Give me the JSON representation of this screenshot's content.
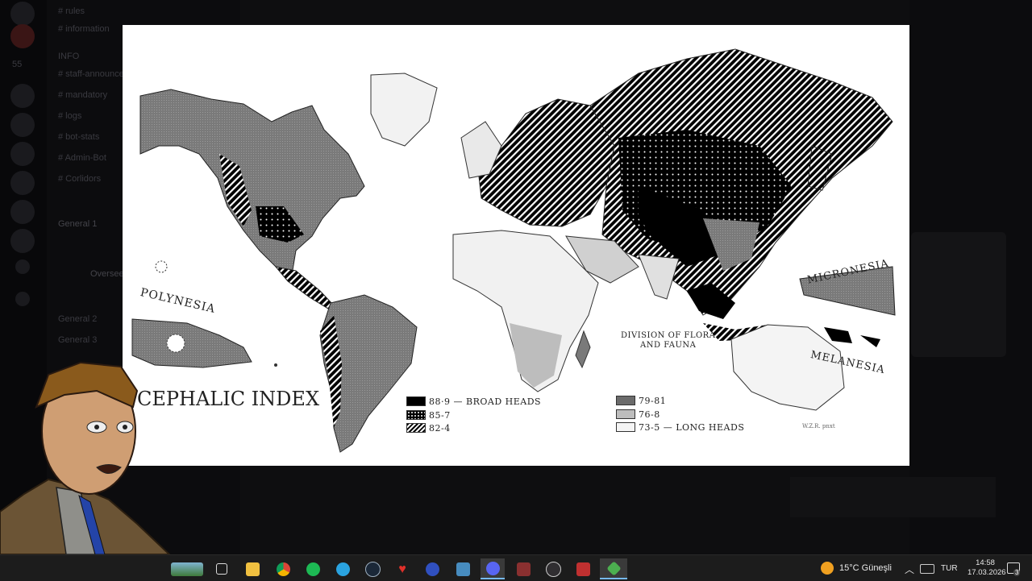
{
  "background": {
    "server_rail": {
      "badge": "55"
    },
    "channels": [
      "# rules",
      "# information",
      "INFO",
      "# staff-announcements",
      "# mandatory",
      "# logs",
      "# bot-stats",
      "# Admin-Bot",
      "# Corlidors",
      "General 1",
      "Overseer",
      "General 2",
      "General 3"
    ]
  },
  "map": {
    "title": "CEPHALIC INDEX",
    "labels": {
      "polynesia": "POLYNESIA",
      "micronesia": "MICRONESIA",
      "melanesia": "MELANESIA",
      "wallace_line": [
        "DIVISION OF FLORA",
        "AND FAUNA"
      ],
      "credit": "W.Z.R. pnxt"
    },
    "legend": [
      {
        "pattern": "black",
        "label": "88·9 — BROAD HEADS"
      },
      {
        "pattern": "dots",
        "label": "85-7"
      },
      {
        "pattern": "diag",
        "label": "82-4"
      },
      {
        "pattern": "dgrey",
        "label": "79-81"
      },
      {
        "pattern": "lgrey",
        "label": "76-8"
      },
      {
        "pattern": "white",
        "label": "73-5 — LONG HEADS"
      }
    ]
  },
  "taskbar": {
    "apps": [
      {
        "icon": "landscape-thumbnail-icon"
      },
      {
        "icon": "task-view-icon"
      },
      {
        "icon": "file-explorer-icon",
        "color": "#f0c040"
      },
      {
        "icon": "chrome-icon",
        "color": "#db4437"
      },
      {
        "icon": "spotify-icon",
        "color": "#1db954"
      },
      {
        "icon": "telegram-icon",
        "color": "#2aa3e0"
      },
      {
        "icon": "steam-icon",
        "color": "#1b2838"
      },
      {
        "icon": "heart-app-icon",
        "color": "#e0302a"
      },
      {
        "icon": "radio-app-icon",
        "color": "#3050c0"
      },
      {
        "icon": "godot-icon",
        "color": "#478cbf"
      },
      {
        "icon": "discord-icon",
        "color": "#5865f2"
      },
      {
        "icon": "winrar-icon",
        "color": "#8a3030"
      },
      {
        "icon": "obs-icon",
        "color": "#302e31"
      },
      {
        "icon": "vpn-shield-icon",
        "color": "#c03030"
      },
      {
        "icon": "emerald-app-icon",
        "color": "#4caf50"
      }
    ],
    "weather": {
      "temp": "15°C",
      "condition": "Güneşli"
    },
    "language": "TUR",
    "time": "14:58",
    "date": "17.03.2026",
    "notifications": "3"
  }
}
